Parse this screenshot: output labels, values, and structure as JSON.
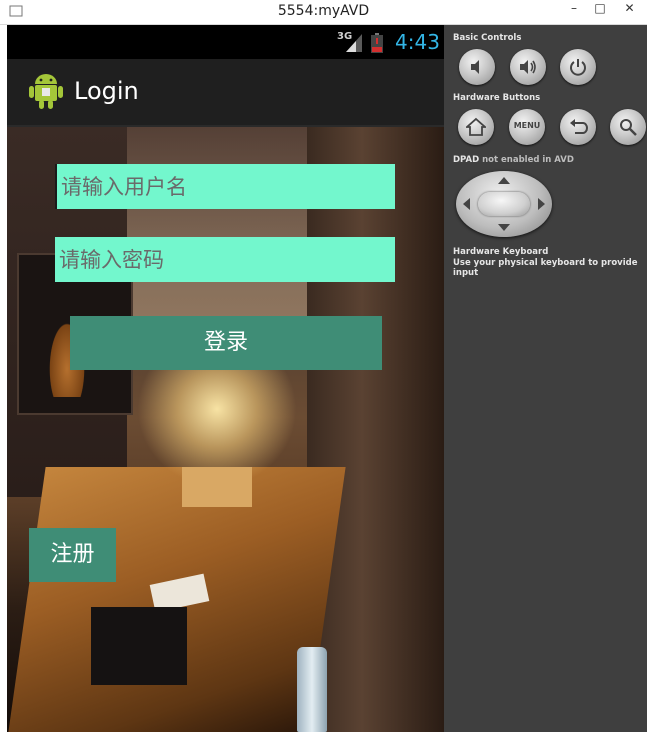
{
  "window": {
    "title": "5554:myAVD",
    "minimize": "–",
    "maximize": "□",
    "close": "✕"
  },
  "statusbar": {
    "network": "3G",
    "time": "4:43",
    "clock_color": "#33b5e5"
  },
  "actionbar": {
    "title": "Login",
    "icon": "android-icon"
  },
  "form": {
    "username_placeholder": "请输入用户名",
    "username_value": "",
    "password_placeholder": "请输入密码",
    "password_value": "",
    "login_label": "登录",
    "register_label": "注册",
    "field_color": "#73f7cd",
    "button_color": "#3f8d76"
  },
  "panel": {
    "basic_controls": "Basic Controls",
    "hardware_buttons": "Hardware Buttons",
    "dpad_label": "DPAD",
    "dpad_note": "not enabled in AVD",
    "keyboard_title": "Hardware Keyboard",
    "keyboard_note": "Use your physical keyboard to provide input",
    "menu_label": "MENU"
  }
}
